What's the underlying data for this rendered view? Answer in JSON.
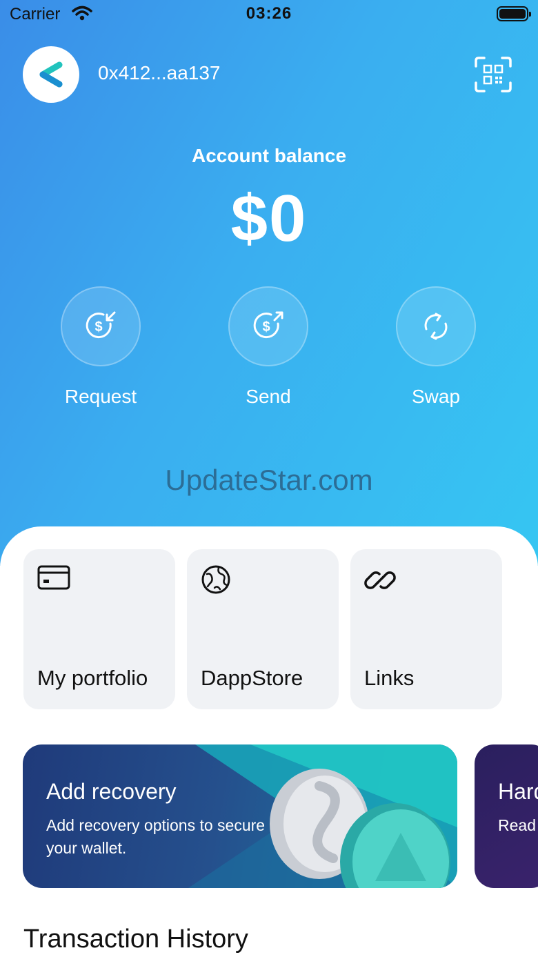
{
  "status_bar": {
    "carrier": "Carrier",
    "time": "03:26"
  },
  "header": {
    "address": "0x412...aa137",
    "qr_icon": "qr-scan-icon",
    "avatar_icon": "back-chevron-logo-icon"
  },
  "balance": {
    "label": "Account balance",
    "value": "$0"
  },
  "actions": [
    {
      "label": "Request",
      "icon": "dollar-receive-icon"
    },
    {
      "label": "Send",
      "icon": "dollar-send-icon"
    },
    {
      "label": "Swap",
      "icon": "swap-arrows-icon"
    }
  ],
  "watermark": "UpdateStar.com",
  "tiles": [
    {
      "label": "My portfolio",
      "icon": "card-icon"
    },
    {
      "label": "DappStore",
      "icon": "globe-icon"
    },
    {
      "label": "Links",
      "icon": "link-icon"
    }
  ],
  "banners": [
    {
      "title": "Add recovery",
      "subtitle": "Add recovery options to secure your wallet."
    },
    {
      "title": "Hard",
      "subtitle": "Read hardw"
    }
  ],
  "transactions": {
    "title": "Transaction History"
  },
  "colors": {
    "gradient_start": "#3a8de8",
    "gradient_end": "#36c6f2",
    "accent_teal": "#2ec6c0",
    "banner_dark": "#1f3a7a"
  }
}
